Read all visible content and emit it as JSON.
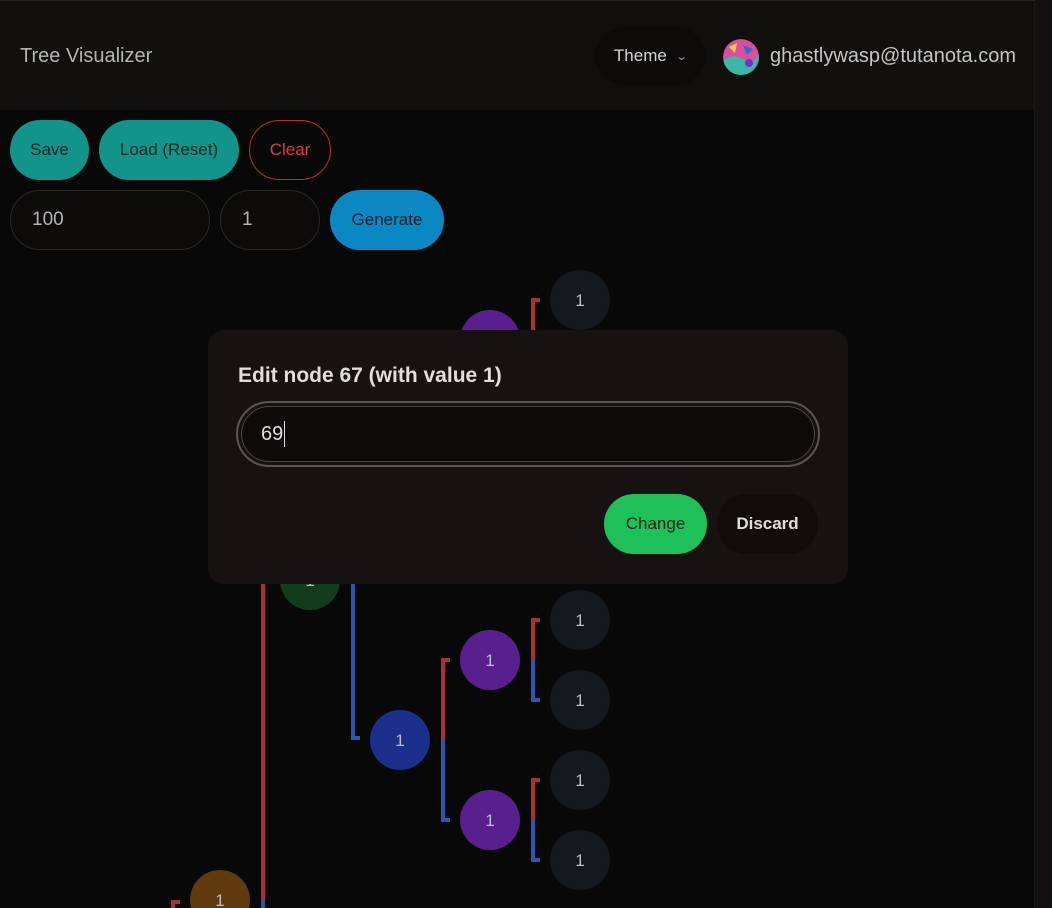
{
  "navbar": {
    "title": "Tree Visualizer",
    "theme_label": "Theme",
    "user_email": "ghastlywasp@tutanota.com"
  },
  "toolbar": {
    "save_label": "Save",
    "load_label": "Load (Reset)",
    "clear_label": "Clear",
    "size_value": "100",
    "node_value": "1",
    "generate_label": "Generate"
  },
  "tree": {
    "node_label": "1",
    "colors": {
      "leaf": "#14181f",
      "depth_1": "#5a1f8e",
      "depth_2": "#1b2f8c",
      "depth_3": "#123d1d",
      "depth_4": "#5e3a0d",
      "edge_left": "#a63232",
      "edge_right": "#2d55b0"
    }
  },
  "modal": {
    "title": "Edit node 67 (with value 1)",
    "input_value": "69",
    "change_label": "Change",
    "discard_label": "Discard",
    "change_color": "#1ec05a"
  }
}
